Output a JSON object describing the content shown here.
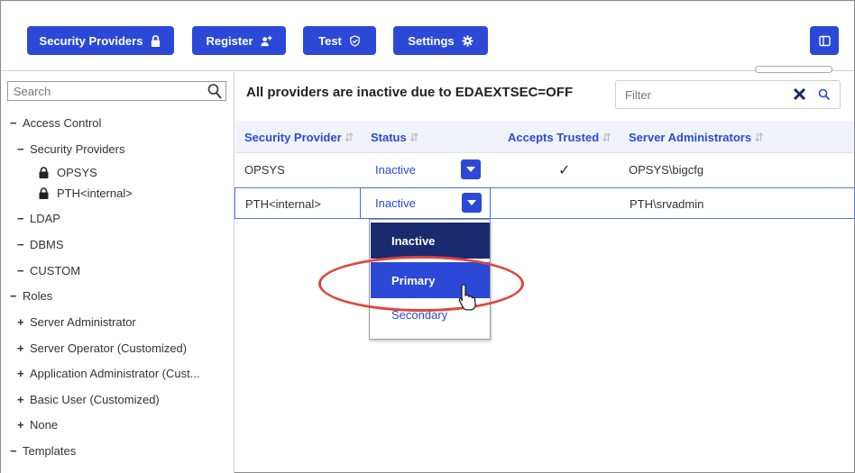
{
  "toolbar": {
    "buttons": [
      {
        "label": "Security Providers",
        "icon": "lock-icon"
      },
      {
        "label": "Register",
        "icon": "add-user-icon"
      },
      {
        "label": "Test",
        "icon": "shield-check-icon"
      },
      {
        "label": "Settings",
        "icon": "gear-icon"
      }
    ],
    "panel_icon": "panel-toggle-icon"
  },
  "sidebar": {
    "search_placeholder": "Search",
    "tree": [
      {
        "label": "Access Control",
        "sym": "−"
      },
      {
        "label": "Security Providers",
        "sym": "−"
      },
      {
        "label": "OPSYS",
        "icon": "lock-icon"
      },
      {
        "label": "PTH<internal>",
        "icon": "lock-icon"
      },
      {
        "label": "LDAP",
        "sym": "−"
      },
      {
        "label": "DBMS",
        "sym": "−"
      },
      {
        "label": "CUSTOM",
        "sym": "−"
      },
      {
        "label": "Roles",
        "sym": "−"
      },
      {
        "label": "Server Administrator",
        "sym": "+"
      },
      {
        "label": "Server Operator (Customized)",
        "sym": "+"
      },
      {
        "label": "Application Administrator (Cust...",
        "sym": "+"
      },
      {
        "label": "Basic User (Customized)",
        "sym": "+"
      },
      {
        "label": "None",
        "sym": "+"
      },
      {
        "label": "Templates",
        "sym": "−"
      }
    ]
  },
  "main": {
    "banner": "All providers are inactive due to EDAEXTSEC=OFF",
    "filter_placeholder": "Filter",
    "columns": [
      "Security Provider",
      "Status",
      "Accepts Trusted",
      "Server Administrators"
    ],
    "rows": [
      {
        "provider": "OPSYS",
        "status": "Inactive",
        "accepts_trusted": "✓",
        "admins": "OPSYS\\bigcfg"
      },
      {
        "provider": "PTH<internal>",
        "status": "Inactive",
        "accepts_trusted": "",
        "admins": "PTH\\srvadmin"
      }
    ],
    "dropdown": {
      "options": [
        "Inactive",
        "Primary",
        "Secondary"
      ],
      "highlighted": "Primary"
    }
  },
  "colors": {
    "accent": "#2b49d6",
    "dark_accent": "#1a2a6e",
    "annotation": "#e0453f"
  }
}
